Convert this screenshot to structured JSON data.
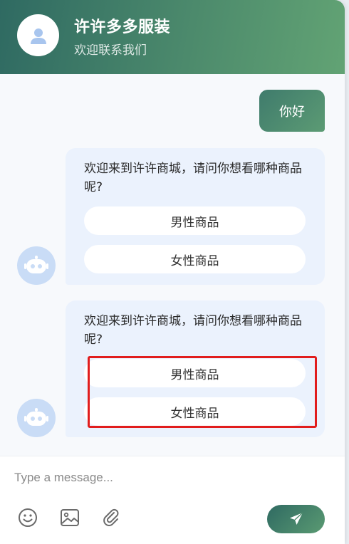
{
  "header": {
    "title": "许许多多服装",
    "subtitle": "欢迎联系我们"
  },
  "messages": {
    "user_1": "你好",
    "bot_1": {
      "text": "欢迎来到许许商城，请问你想看哪种商品呢?",
      "options": [
        "男性商品",
        "女性商品"
      ]
    },
    "bot_2": {
      "text": "欢迎来到许许商城，请问你想看哪种商品呢?",
      "options": [
        "男性商品",
        "女性商品"
      ]
    }
  },
  "input": {
    "placeholder": "Type a message..."
  },
  "icons": {
    "avatar": "user-icon",
    "bot": "robot-icon",
    "emoji": "smiley-icon",
    "image": "image-icon",
    "attach": "paperclip-icon",
    "send": "send-icon"
  },
  "colors": {
    "header_start": "#2f6a62",
    "header_end": "#62a374",
    "bot_bubble": "#ebf2fd",
    "highlight": "#e11d1d"
  }
}
